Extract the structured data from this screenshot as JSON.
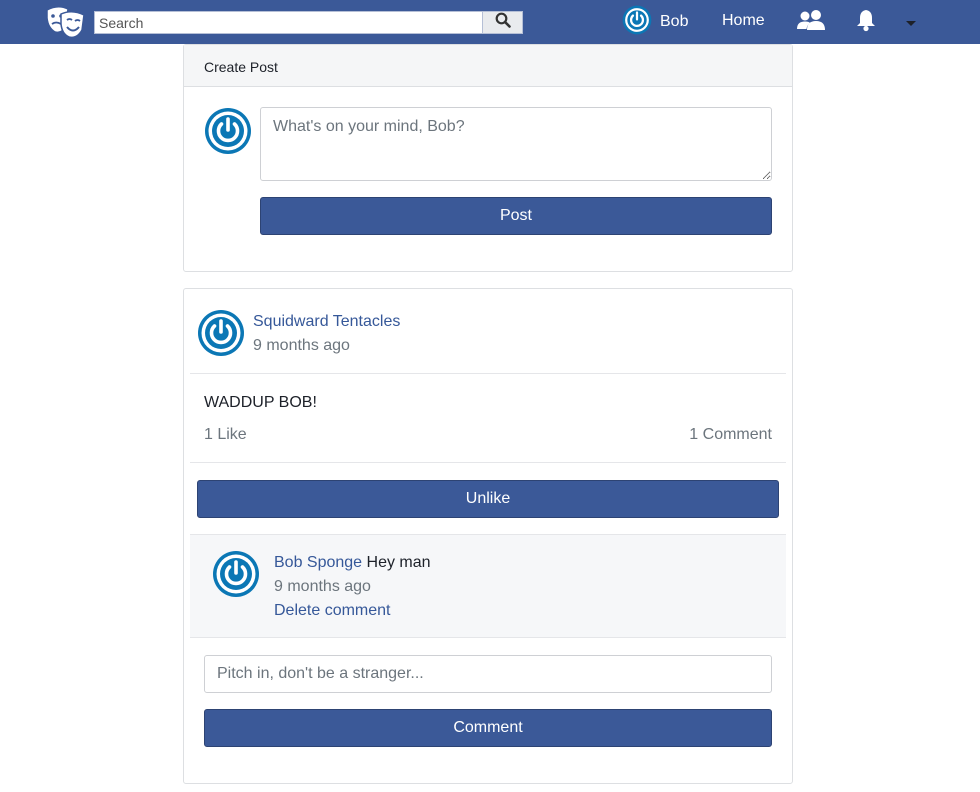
{
  "navbar": {
    "search_placeholder": "Search",
    "user_name": "Bob",
    "home_label": "Home",
    "icons": [
      "logo-masks-icon",
      "search-icon",
      "friends-icon",
      "bell-icon",
      "caret-down-icon"
    ]
  },
  "create_post": {
    "header": "Create Post",
    "placeholder": "What's on your mind, Bob?",
    "post_button": "Post"
  },
  "post": {
    "author": "Squidward Tentacles",
    "time": "9 months ago",
    "text": "WADDUP BOB!",
    "likes": "1 Like",
    "comments_count": "1 Comment",
    "unlike_button": "Unlike",
    "comments": [
      {
        "author": "Bob Sponge",
        "text": "Hey man",
        "time": "9 months ago",
        "delete_label": "Delete comment"
      }
    ],
    "comment_placeholder": "Pitch in, don't be a stranger...",
    "comment_button": "Comment"
  },
  "colors": {
    "navbar_bg": "#3b5998",
    "link": "#365899",
    "avatar_ring": "#0b77b5"
  }
}
